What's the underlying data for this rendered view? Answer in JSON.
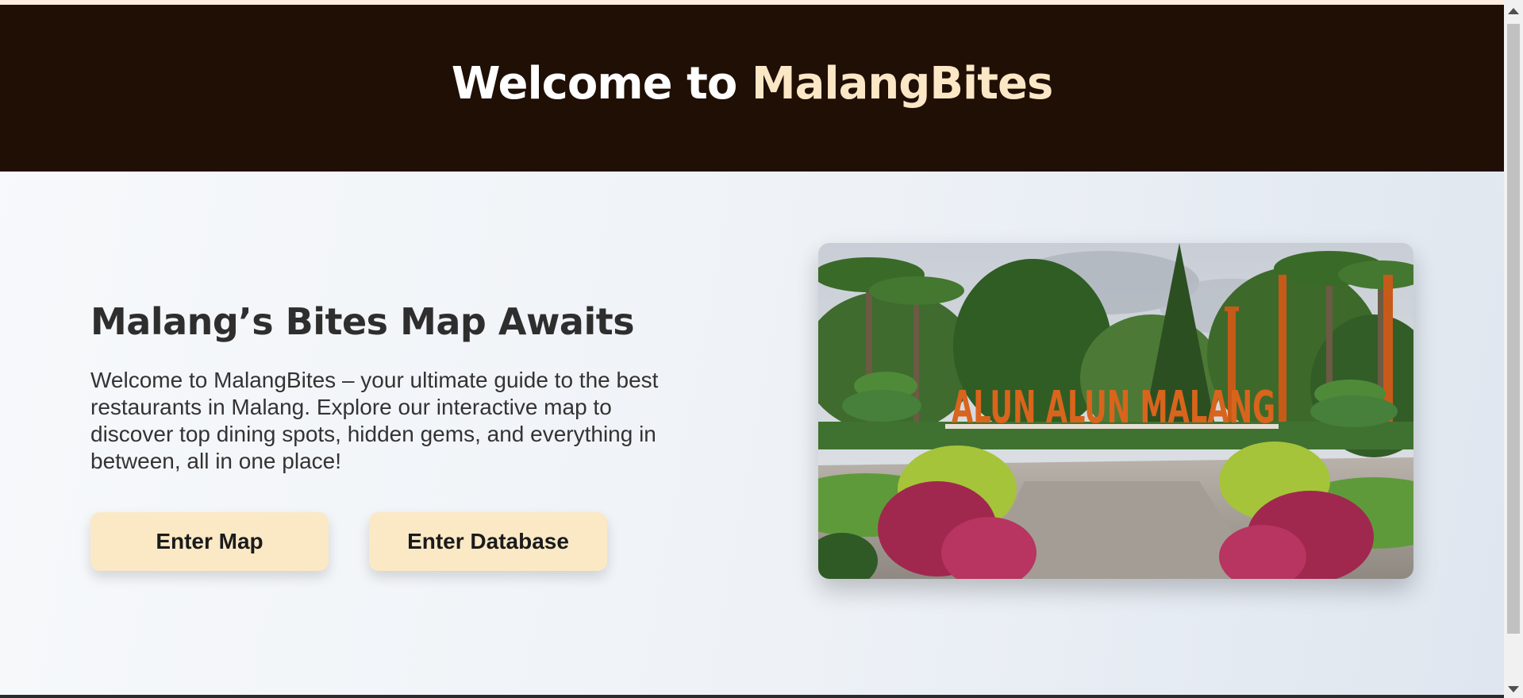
{
  "header": {
    "title_prefix": "Welcome to ",
    "title_brand": "MalangBites"
  },
  "hero": {
    "heading": "Malang’s Bites Map Awaits",
    "description": "Welcome to MalangBites – your ultimate guide to the best restaurants in Malang. Explore our interactive map to discover top dining spots, hidden gems, and everything in between, all in one place!",
    "buttons": {
      "map": "Enter Map",
      "database": "Enter Database"
    },
    "image": {
      "sign_text": "ALUN ALUN MALANG"
    }
  },
  "colors": {
    "header_bg": "#1f0f05",
    "brand_accent": "#fbe7c6",
    "button_bg": "#fbe9c6",
    "sign_orange": "#d9641c"
  }
}
